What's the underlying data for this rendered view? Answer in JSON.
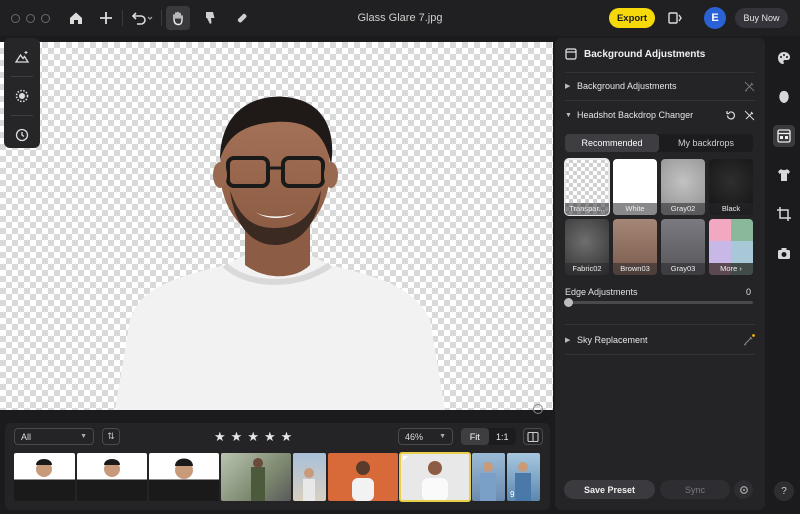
{
  "window": {
    "title": "Glass Glare 7.jpg"
  },
  "toolbar": {
    "export_label": "Export",
    "avatar_initial": "E",
    "buy_label": "Buy Now"
  },
  "filmstrip": {
    "filter_value": "All",
    "zoom_value": "46%",
    "fit_label": "Fit",
    "one_to_one_label": "1:1",
    "stack_count": "9",
    "rating_stars": 5
  },
  "panel": {
    "title": "Background Adjustments",
    "section_background": "Background Adjustments",
    "section_headshot": "Headshot Backdrop Changer",
    "tab_recommended": "Recommended",
    "tab_my_backdrops": "My backdrops",
    "swatches": [
      {
        "label": "Transpar..."
      },
      {
        "label": "White"
      },
      {
        "label": "Gray02"
      },
      {
        "label": "Black"
      },
      {
        "label": "Fabric02"
      },
      {
        "label": "Brown03"
      },
      {
        "label": "Gray03"
      },
      {
        "label": "More"
      }
    ],
    "edge_label": "Edge Adjustments",
    "edge_value": "0",
    "section_sky": "Sky Replacement",
    "save_preset_label": "Save Preset",
    "sync_label": "Sync"
  },
  "colors": {
    "accent_yellow": "#f5d90a",
    "avatar_blue": "#2a62d6",
    "panel_bg": "#242427"
  },
  "help_label": "?"
}
